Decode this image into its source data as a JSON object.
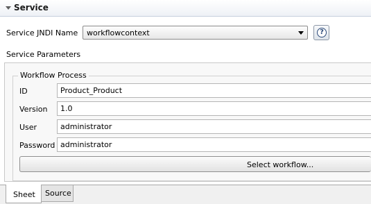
{
  "section": {
    "title": "Service"
  },
  "service": {
    "jndi_label": "Service JNDI Name",
    "jndi_value": "workflowcontext",
    "help_symbol": "?",
    "params_label": "Service Parameters"
  },
  "workflow": {
    "group_title": "Workflow Process",
    "fields": [
      {
        "label": "ID",
        "value": "Product_Product"
      },
      {
        "label": "Version",
        "value": "1.0"
      },
      {
        "label": "User",
        "value": "administrator"
      },
      {
        "label": "Password",
        "value": "administrator"
      }
    ],
    "select_button": "Select workflow..."
  },
  "tabs": [
    "Sheet",
    "Source"
  ],
  "icons": {
    "section_toggle": "chevron-down-icon",
    "help": "help-icon",
    "combo_arrow": "dropdown-arrow-icon"
  }
}
